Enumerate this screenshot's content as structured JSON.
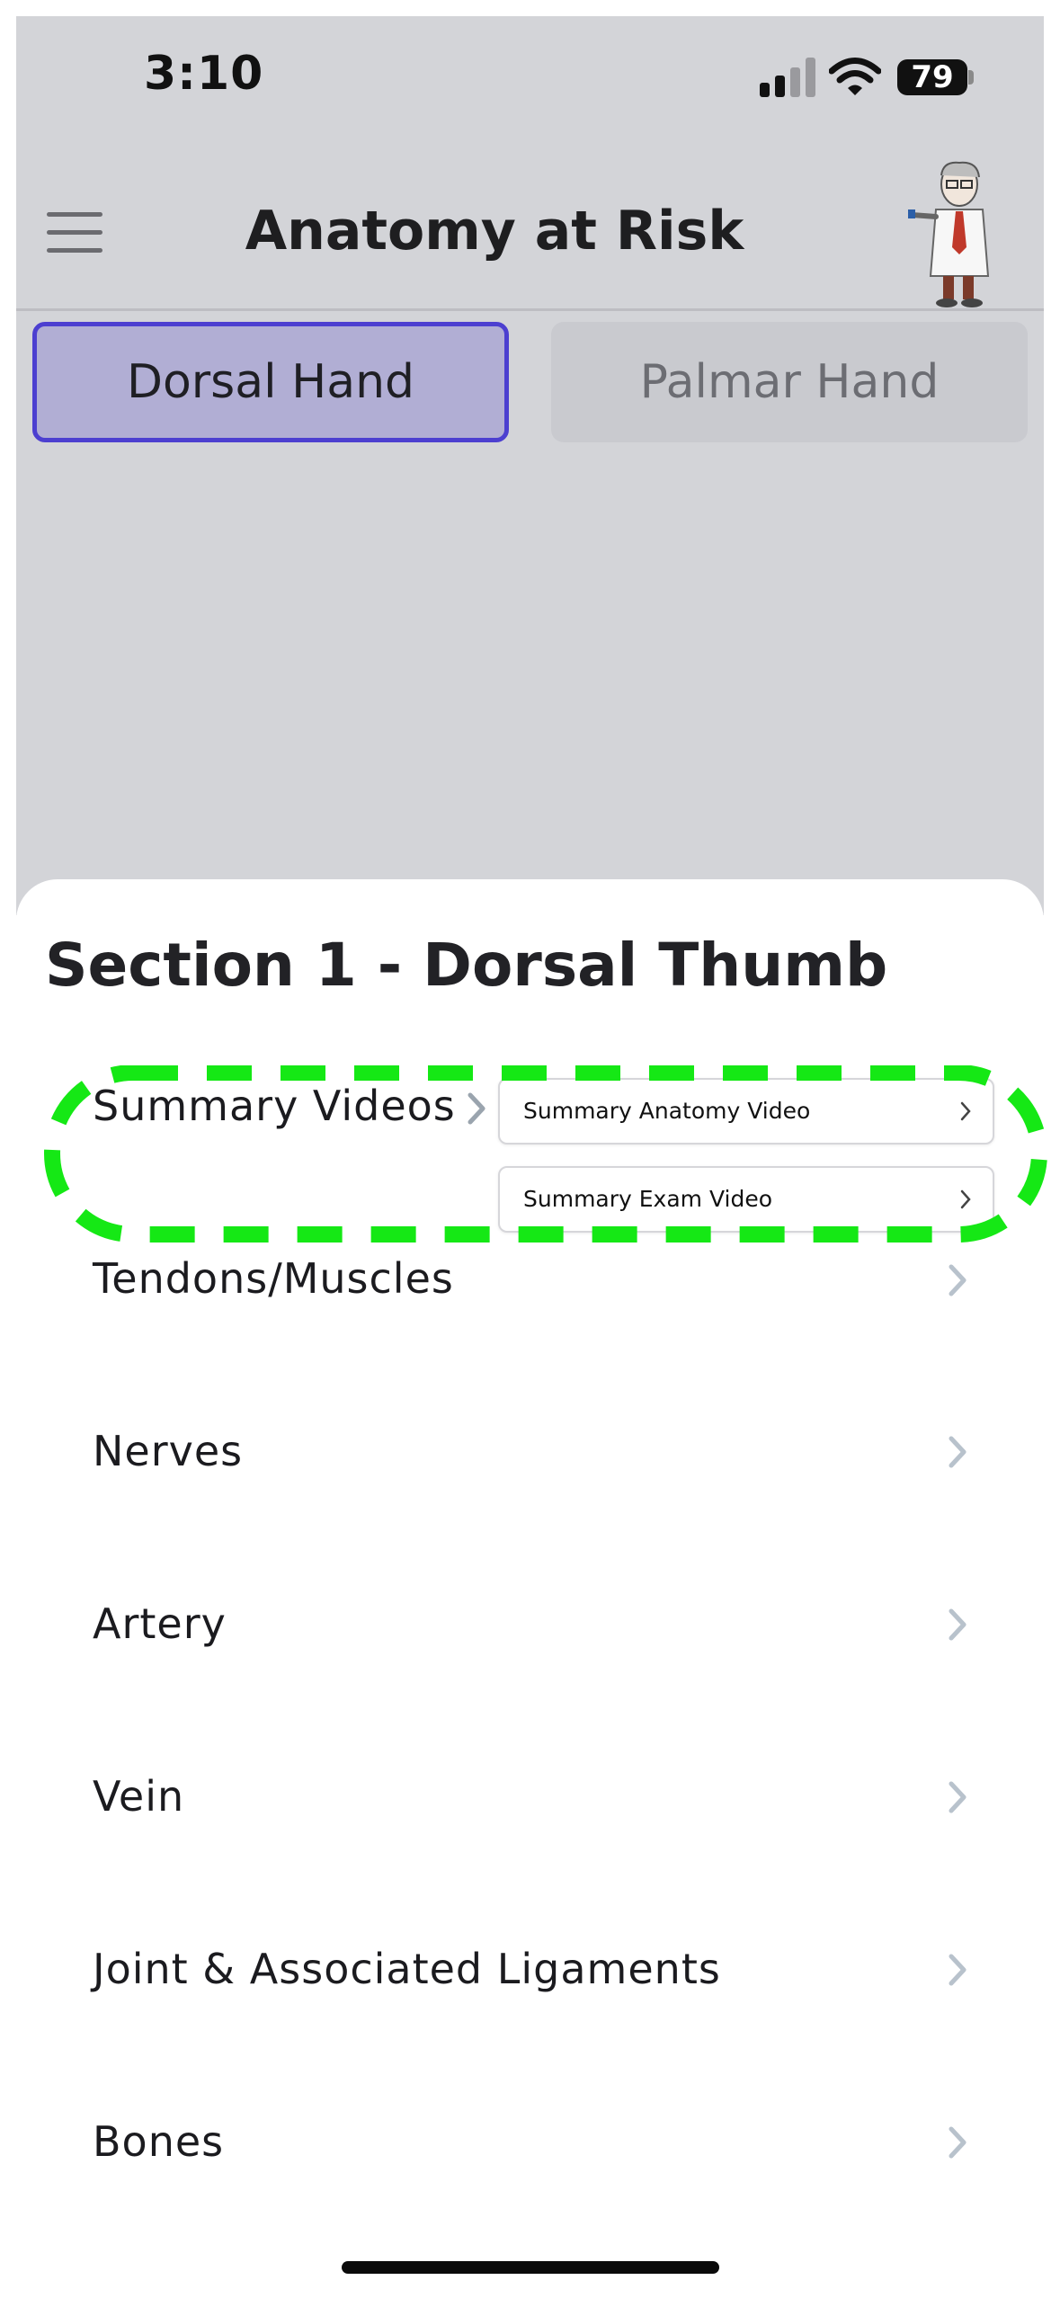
{
  "status_bar": {
    "time": "3:10",
    "battery": "79",
    "icons": [
      "cellular-signal-icon",
      "wifi-icon",
      "battery-icon"
    ]
  },
  "header": {
    "title": "Anatomy at Risk",
    "menu_icon": "hamburger-menu-icon",
    "mascot": "doctor-mascot-image"
  },
  "tabs": [
    {
      "label": "Dorsal Hand",
      "active": true
    },
    {
      "label": "Palmar Hand",
      "active": false
    }
  ],
  "sheet": {
    "title": "Section 1 - Dorsal Thumb",
    "rows": [
      {
        "label": "Summary Videos",
        "expanded": true,
        "sub_items": [
          {
            "label": "Summary Anatomy Video"
          },
          {
            "label": "Summary Exam Video"
          }
        ]
      },
      {
        "label": "Tendons/Muscles"
      },
      {
        "label": "Nerves"
      },
      {
        "label": "Artery"
      },
      {
        "label": "Vein"
      },
      {
        "label": "Joint & Associated Ligaments"
      },
      {
        "label": "Bones"
      }
    ]
  },
  "colors": {
    "background_dim": "#d3d4d8",
    "tab_active_fill": "#b1aed4",
    "tab_active_border": "#4c3fd0",
    "highlight_dash": "#15e815",
    "chevron": "#b8c2cc"
  }
}
